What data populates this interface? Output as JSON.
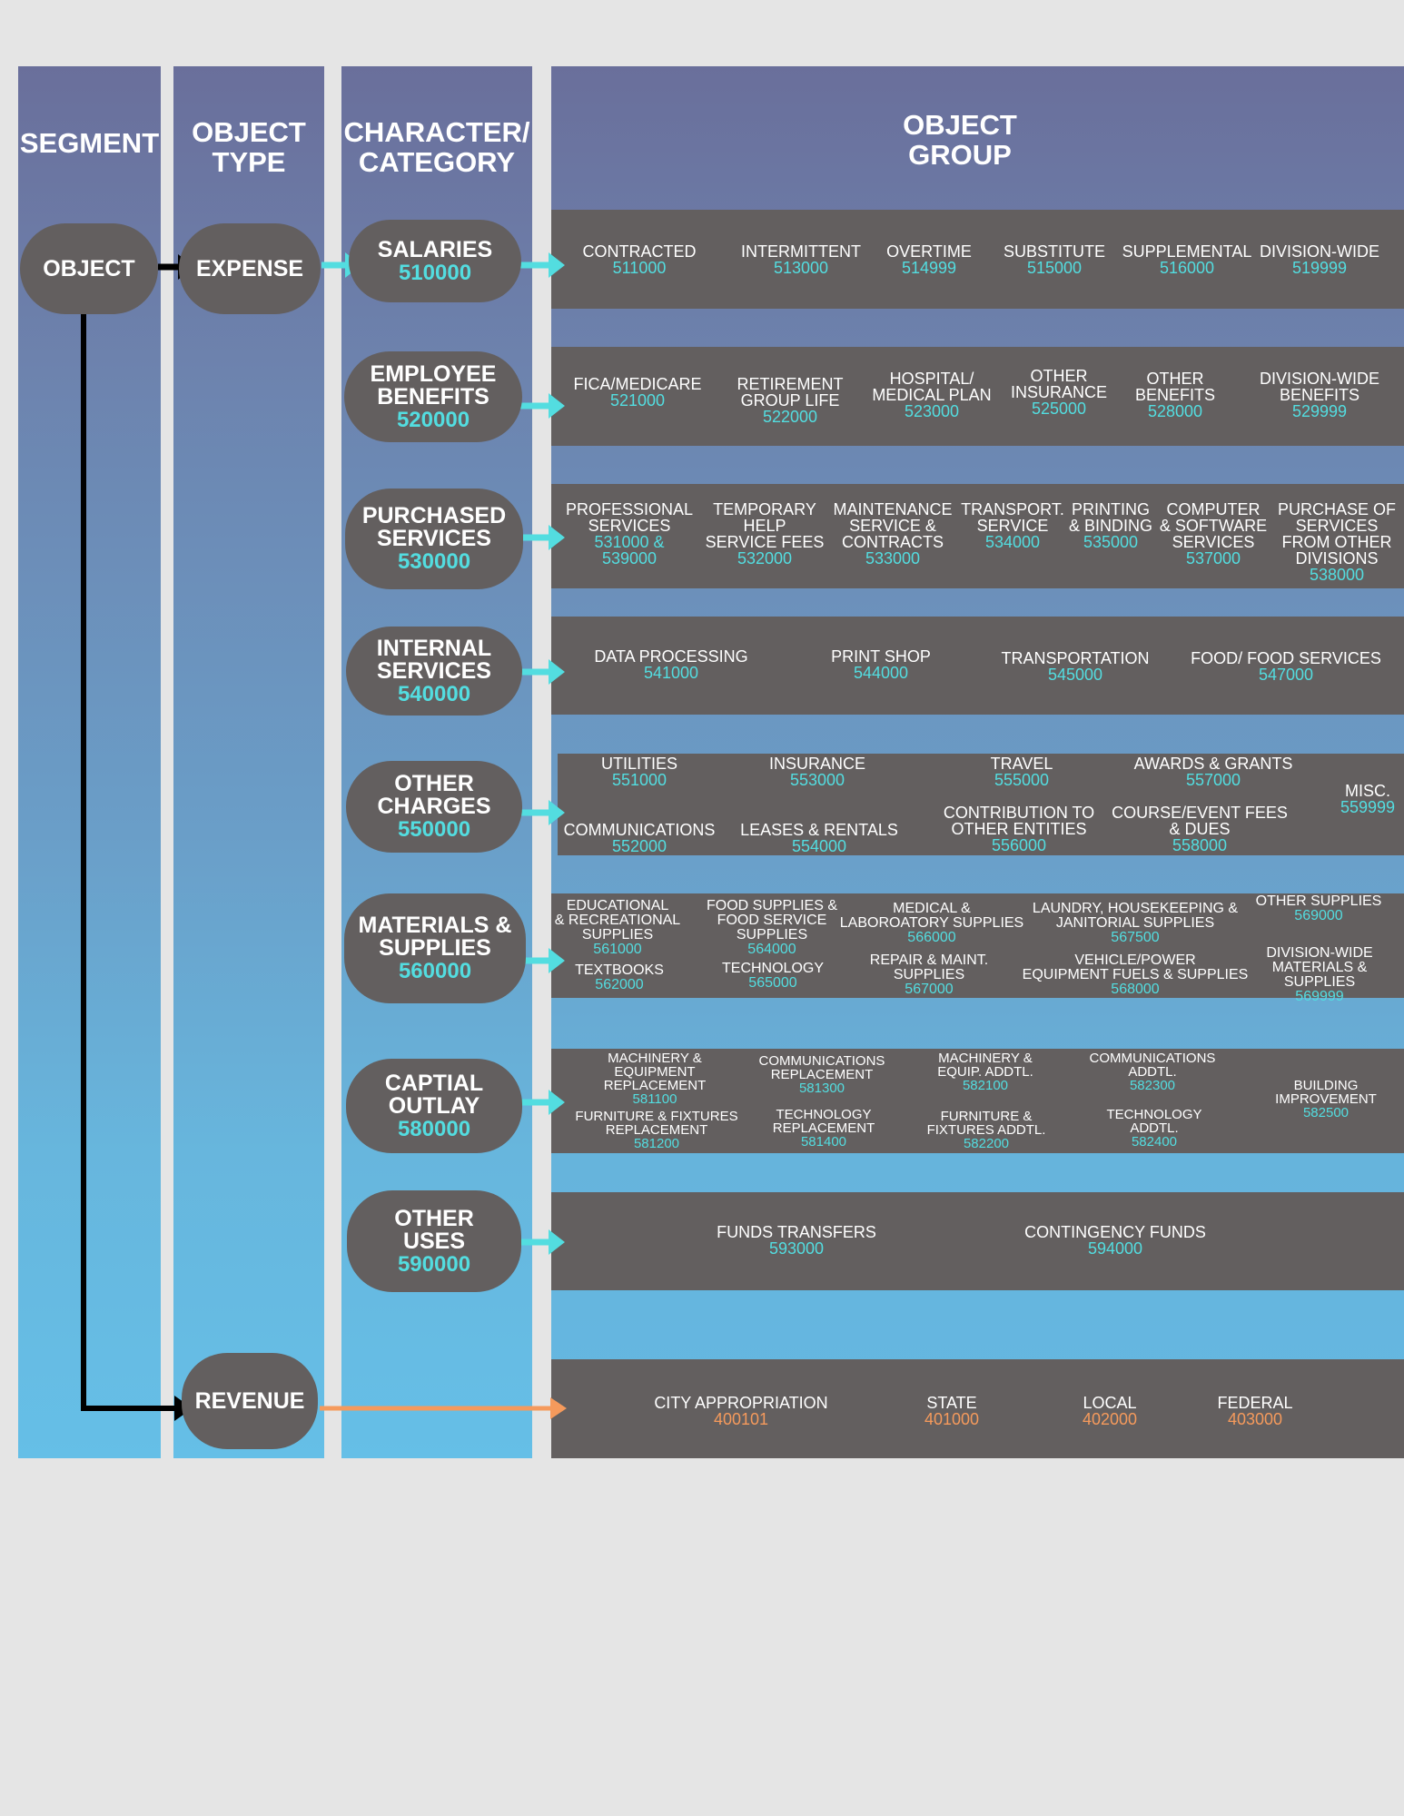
{
  "headers": {
    "segment": "SEGMENT",
    "object_type": [
      "OBJECT",
      "TYPE"
    ],
    "character_category": [
      "CHARACTER/",
      "CATEGORY"
    ],
    "object_group": [
      "OBJECT",
      "GROUP"
    ]
  },
  "segment_node": "OBJECT",
  "object_types": {
    "expense": "EXPENSE",
    "revenue": "REVENUE"
  },
  "colors": {
    "code_cyan": "#53dde0",
    "revenue_orange": "#f59a5c",
    "node_gray": "#635f5f"
  },
  "categories": [
    {
      "lines": [
        "SALARIES"
      ],
      "code": "510000"
    },
    {
      "lines": [
        "EMPLOYEE",
        "BENEFITS"
      ],
      "code": "520000"
    },
    {
      "lines": [
        "PURCHASED",
        "SERVICES"
      ],
      "code": "530000"
    },
    {
      "lines": [
        "INTERNAL",
        "SERVICES"
      ],
      "code": "540000"
    },
    {
      "lines": [
        "OTHER",
        "CHARGES"
      ],
      "code": "550000"
    },
    {
      "lines": [
        "MATERIALS &",
        "SUPPLIES"
      ],
      "code": "560000"
    },
    {
      "lines": [
        "CAPTIAL",
        "OUTLAY"
      ],
      "code": "580000"
    },
    {
      "lines": [
        "OTHER",
        "USES"
      ],
      "code": "590000"
    }
  ],
  "groups": [
    [
      {
        "lines": [
          "CONTRACTED"
        ],
        "code": "511000"
      },
      {
        "lines": [
          "INTERMITTENT"
        ],
        "code": "513000"
      },
      {
        "lines": [
          "OVERTIME"
        ],
        "code": "514999"
      },
      {
        "lines": [
          "SUBSTITUTE"
        ],
        "code": "515000"
      },
      {
        "lines": [
          "SUPPLEMENTAL"
        ],
        "code": "516000"
      },
      {
        "lines": [
          "DIVISION-WIDE"
        ],
        "code": "519999"
      }
    ],
    [
      {
        "lines": [
          "FICA/MEDICARE"
        ],
        "code": "521000"
      },
      {
        "lines": [
          "RETIREMENT",
          "GROUP LIFE"
        ],
        "code": "522000"
      },
      {
        "lines": [
          "HOSPITAL/",
          "MEDICAL PLAN"
        ],
        "code": "523000"
      },
      {
        "lines": [
          "OTHER",
          "INSURANCE"
        ],
        "code": "525000"
      },
      {
        "lines": [
          "OTHER",
          "BENEFITS"
        ],
        "code": "528000"
      },
      {
        "lines": [
          "DIVISION-WIDE",
          "BENEFITS"
        ],
        "code": "529999"
      }
    ],
    [
      {
        "lines": [
          "PROFESSIONAL",
          "SERVICES"
        ],
        "code_lines": [
          "531000 &",
          "539000"
        ]
      },
      {
        "lines": [
          "TEMPORARY",
          "HELP",
          "SERVICE FEES"
        ],
        "code": "532000"
      },
      {
        "lines": [
          "MAINTENANCE",
          "SERVICE &",
          "CONTRACTS"
        ],
        "code": "533000"
      },
      {
        "lines": [
          "TRANSPORT.",
          "SERVICE"
        ],
        "code": "534000"
      },
      {
        "lines": [
          "PRINTING",
          "& BINDING"
        ],
        "code": "535000"
      },
      {
        "lines": [
          "COMPUTER",
          "& SOFTWARE",
          "SERVICES"
        ],
        "code": "537000"
      },
      {
        "lines": [
          "PURCHASE OF",
          "SERVICES",
          "FROM OTHER",
          "DIVISIONS"
        ],
        "code": "538000"
      }
    ],
    [
      {
        "lines": [
          "DATA PROCESSING"
        ],
        "code": "541000"
      },
      {
        "lines": [
          "PRINT SHOP"
        ],
        "code": "544000"
      },
      {
        "lines": [
          "TRANSPORTATION"
        ],
        "code": "545000"
      },
      {
        "lines": [
          "FOOD/ FOOD SERVICES"
        ],
        "code": "547000"
      }
    ],
    [
      {
        "lines": [
          "UTILITIES"
        ],
        "code": "551000"
      },
      {
        "lines": [
          "INSURANCE"
        ],
        "code": "553000"
      },
      {
        "lines": [
          "TRAVEL"
        ],
        "code": "555000"
      },
      {
        "lines": [
          "AWARDS & GRANTS"
        ],
        "code": "557000"
      },
      {
        "lines": [
          "MISC."
        ],
        "code": "559999"
      },
      {
        "lines": [
          "COMMUNICATIONS"
        ],
        "code": "552000"
      },
      {
        "lines": [
          "LEASES & RENTALS"
        ],
        "code": "554000"
      },
      {
        "lines": [
          "CONTRIBUTION TO",
          "OTHER ENTITIES"
        ],
        "code": "556000"
      },
      {
        "lines": [
          "COURSE/EVENT FEES",
          "& DUES"
        ],
        "code": "558000"
      }
    ],
    [
      {
        "lines": [
          "EDUCATIONAL",
          "& RECREATIONAL",
          "SUPPLIES"
        ],
        "code": "561000"
      },
      {
        "lines": [
          "FOOD SUPPLIES &",
          "FOOD SERVICE",
          "SUPPLIES"
        ],
        "code": "564000"
      },
      {
        "lines": [
          "MEDICAL &",
          "LABOROATORY SUPPLIES"
        ],
        "code": "566000"
      },
      {
        "lines": [
          "LAUNDRY, HOUSEKEEPING &",
          "JANITORIAL SUPPLIES"
        ],
        "code": "567500"
      },
      {
        "lines": [
          "OTHER SUPPLIES"
        ],
        "code": "569000"
      },
      {
        "lines": [
          "TEXTBOOKS"
        ],
        "code": "562000"
      },
      {
        "lines": [
          "TECHNOLOGY"
        ],
        "code": "565000"
      },
      {
        "lines": [
          "REPAIR & MAINT.",
          "SUPPLIES"
        ],
        "code": "567000"
      },
      {
        "lines": [
          "VEHICLE/POWER",
          "EQUIPMENT FUELS & SUPPLIES"
        ],
        "code": "568000"
      },
      {
        "lines": [
          "DIVISION-WIDE",
          "MATERIALS &",
          "SUPPLIES"
        ],
        "code": "569999"
      }
    ],
    [
      {
        "lines": [
          "MACHINERY &",
          "EQUIPMENT",
          "REPLACEMENT"
        ],
        "code": "581100"
      },
      {
        "lines": [
          "COMMUNICATIONS",
          "REPLACEMENT"
        ],
        "code": "581300"
      },
      {
        "lines": [
          "MACHINERY &",
          "EQUIP. ADDTL."
        ],
        "code": "582100"
      },
      {
        "lines": [
          "COMMUNICATIONS",
          "ADDTL."
        ],
        "code": "582300"
      },
      {
        "lines": [
          "BUILDING",
          "IMPROVEMENT"
        ],
        "code": "582500"
      },
      {
        "lines": [
          "FURNITURE & FIXTURES",
          "REPLACEMENT"
        ],
        "code": "581200"
      },
      {
        "lines": [
          "TECHNOLOGY",
          "REPLACEMENT"
        ],
        "code": "581400"
      },
      {
        "lines": [
          "FURNITURE &",
          "FIXTURES ADDTL."
        ],
        "code": "582200"
      },
      {
        "lines": [
          "TECHNOLOGY",
          "ADDTL."
        ],
        "code": "582400"
      }
    ],
    [
      {
        "lines": [
          "FUNDS TRANSFERS"
        ],
        "code": "593000"
      },
      {
        "lines": [
          "CONTINGENCY FUNDS"
        ],
        "code": "594000"
      }
    ]
  ],
  "revenue_groups": [
    {
      "lines": [
        "CITY APPROPRIATION"
      ],
      "code": "400101"
    },
    {
      "lines": [
        "STATE"
      ],
      "code": "401000"
    },
    {
      "lines": [
        "LOCAL"
      ],
      "code": "402000"
    },
    {
      "lines": [
        "FEDERAL"
      ],
      "code": "403000"
    }
  ]
}
